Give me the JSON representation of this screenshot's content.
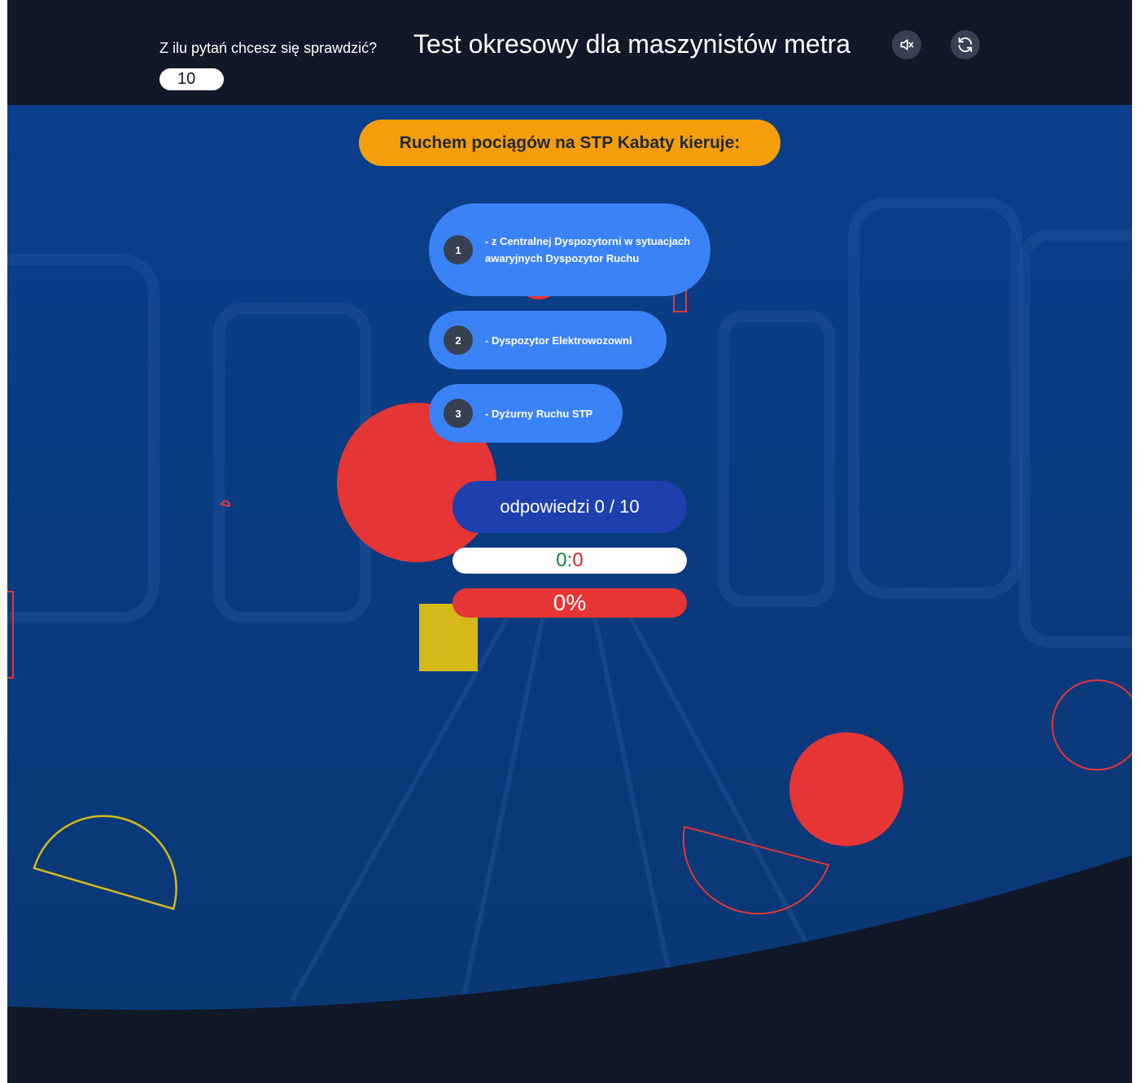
{
  "header": {
    "count_label": "Z ilu pytań chcesz się sprawdzić?",
    "count_value": "10",
    "title": "Test okresowy dla maszynistów metra",
    "mute_icon": "speaker-muted-icon",
    "refresh_icon": "refresh-icon"
  },
  "quiz": {
    "question": "Ruchem pociągów na STP Kabaty kieruje:",
    "answers": [
      {
        "number": "1",
        "text": "- z Centralnej Dyspozytorni w sytuacjach awaryjnych Dyspozytor Ruchu"
      },
      {
        "number": "2",
        "text": "- Dyspozytor Elektrowozowni"
      },
      {
        "number": "3",
        "text": "- Dyżurny Ruchu STP"
      }
    ]
  },
  "progress": {
    "answers_label": "odpowiedzi 0 / 10",
    "correct": "0",
    "separator": ":",
    "wrong": "0",
    "percent": "0%"
  },
  "colors": {
    "header_bg": "#111827",
    "scene_bg": "#0b3f8c",
    "question_bg": "#f59e0b",
    "answer_bg": "#3b82f6",
    "counter_bg": "#1e40af",
    "percent_bg": "#e53535",
    "shape_red": "#e53535",
    "shape_yellow": "#d4b919"
  }
}
